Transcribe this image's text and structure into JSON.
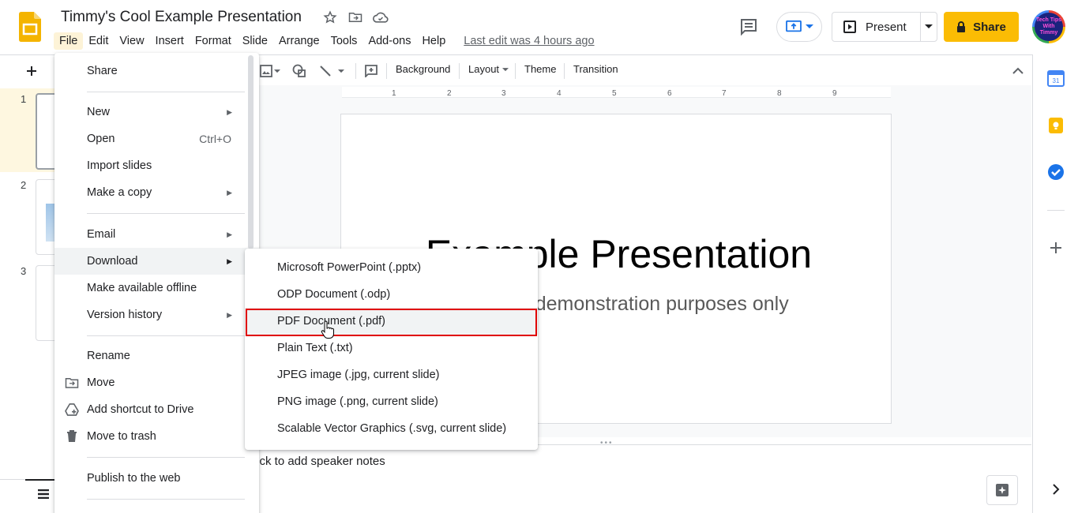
{
  "app": {
    "title": "Timmy's Cool Example Presentation",
    "last_edit": "Last edit was 4 hours ago",
    "avatar_text": "Tech Tips With Timmy"
  },
  "menubar": [
    "File",
    "Edit",
    "View",
    "Insert",
    "Format",
    "Slide",
    "Arrange",
    "Tools",
    "Add-ons",
    "Help"
  ],
  "header": {
    "present_label": "Present",
    "share_label": "Share"
  },
  "toolbar": {
    "background": "Background",
    "layout": "Layout",
    "theme": "Theme",
    "transition": "Transition"
  },
  "ruler_ticks": [
    "1",
    "2",
    "3",
    "4",
    "5",
    "6",
    "7",
    "8",
    "9"
  ],
  "filmstrip": {
    "slide_numbers": [
      "1",
      "2",
      "3"
    ]
  },
  "slide": {
    "title": "Example Presentation",
    "subtitle": "For demonstration purposes only"
  },
  "notes": {
    "placeholder": "Click to add speaker notes"
  },
  "file_menu": {
    "items": [
      {
        "label": "Share"
      },
      {
        "label": "New"
      },
      {
        "label": "Open",
        "shortcut": "Ctrl+O"
      },
      {
        "label": "Import slides"
      },
      {
        "label": "Make a copy"
      },
      {
        "label": "Email"
      },
      {
        "label": "Download"
      },
      {
        "label": "Make available offline"
      },
      {
        "label": "Version history"
      },
      {
        "label": "Rename"
      },
      {
        "label": "Move"
      },
      {
        "label": "Add shortcut to Drive"
      },
      {
        "label": "Move to trash"
      },
      {
        "label": "Publish to the web"
      }
    ]
  },
  "download_menu": {
    "items": [
      {
        "label": "Microsoft PowerPoint (.pptx)"
      },
      {
        "label": "ODP Document (.odp)"
      },
      {
        "label": "PDF Document (.pdf)"
      },
      {
        "label": "Plain Text (.txt)"
      },
      {
        "label": "JPEG image (.jpg, current slide)"
      },
      {
        "label": "PNG image (.png, current slide)"
      },
      {
        "label": "Scalable Vector Graphics (.svg, current slide)"
      }
    ],
    "highlighted_index": 2
  },
  "colors": {
    "share_button": "#fbbc04",
    "highlight_box": "#e00000",
    "menu_hover": "#f1f3f4",
    "slides_brand": "#f4b400"
  }
}
